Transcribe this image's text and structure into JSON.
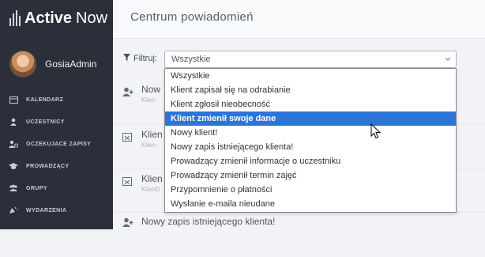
{
  "app": {
    "logo_active": "Active",
    "logo_now": "Now"
  },
  "user": {
    "name": "GosiaAdmin"
  },
  "sidebar": {
    "items": [
      {
        "label": "KALENDARZ",
        "icon": "calendar-icon"
      },
      {
        "label": "UCZESTNICY",
        "icon": "person-icon"
      },
      {
        "label": "OCZEKUJĄCE ZAPISY",
        "icon": "person-pending-icon"
      },
      {
        "label": "PROWADZĄCY",
        "icon": "graduation-cap-icon"
      },
      {
        "label": "GRUPY",
        "icon": "group-icon"
      },
      {
        "label": "WYDARZENIA",
        "icon": "party-icon"
      }
    ]
  },
  "header": {
    "title": "Centrum powiadomień"
  },
  "filter": {
    "label": "Filtruj:",
    "selected": "Wszystkie",
    "options": [
      "Wszystkie",
      "Klient zapisał się na odrabianie",
      "Klient zgłosił nieobecność",
      "Klient zmienił swoje dane",
      "Nowy klient!",
      "Nowy zapis istniejącego klienta!",
      "Prowadzący zmienił informacje o uczestniku",
      "Prowadzący zmienił termin zajęć",
      "Przypomnienie o płatności",
      "Wysłanie e-maila nieudane"
    ],
    "highlighted_index": 3
  },
  "notifications": [
    {
      "title": "Now",
      "sub": "Klien",
      "icon": "person-add-icon"
    },
    {
      "title": "Klien",
      "sub": "Klien",
      "icon": "calendar-x-icon"
    },
    {
      "title": "Klien",
      "sub": "KlienD",
      "icon": "calendar-x-icon"
    },
    {
      "title": "Nowy zapis istniejącego klienta!",
      "sub": "",
      "icon": "person-add-icon"
    }
  ],
  "colors": {
    "sidebar": "#2b2f3a",
    "highlight": "#2d74d9"
  }
}
